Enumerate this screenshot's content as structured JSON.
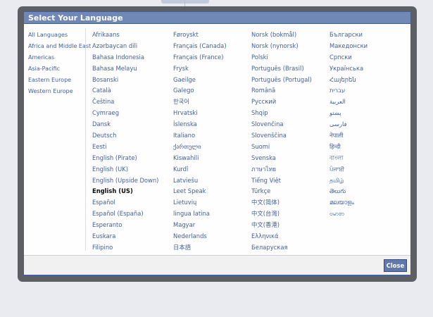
{
  "dialog": {
    "title": "Select Your Language",
    "close_label": "Close"
  },
  "regions": [
    "All Languages",
    "Africa and Middle East",
    "Americas",
    "Asia-Pacific",
    "Eastern Europe",
    "Western Europe"
  ],
  "selected_language": "English (US)",
  "columns": [
    [
      "Afrikaans",
      "Azərbaycan dili",
      "Bahasa Indonesia",
      "Bahasa Melayu",
      "Bosanski",
      "Català",
      "Čeština",
      "Cymraeg",
      "Dansk",
      "Deutsch",
      "Eesti",
      "English (Pirate)",
      "English (UK)",
      "English (Upside Down)",
      "English (US)",
      "Español",
      "Español (España)",
      "Esperanto",
      "Euskara",
      "Filipino"
    ],
    [
      "Føroyskt",
      "Français (Canada)",
      "Français (France)",
      "Frysk",
      "Gaeilge",
      "Galego",
      "한국어",
      "Hrvatski",
      "Íslenska",
      "Italiano",
      "ქართული",
      "Kiswahili",
      "Kurdî",
      "Latviešu",
      "Leet Speak",
      "Lietuvių",
      "lingua latina",
      "Magyar",
      "Nederlands",
      "日本語"
    ],
    [
      "Norsk (bokmål)",
      "Norsk (nynorsk)",
      "Polski",
      "Português (Brasil)",
      "Português (Portugal)",
      "Română",
      "Русский",
      "Shqip",
      "Slovenčina",
      "Slovenščina",
      "Suomi",
      "Svenska",
      "ภาษาไทย",
      "Tiếng Việt",
      "Türkçe",
      "中文(简体)",
      "中文(台灣)",
      "中文(香港)",
      "Ελληνικά",
      "Беларуская"
    ],
    [
      "Български",
      "Македонски",
      "Српски",
      "Українська",
      "Հայերեն",
      "עברית",
      "العربية",
      "پښتو",
      "فارسی",
      "नेपाली",
      "हिन्दी",
      "বাংলা",
      "ਪੰਜਾਬੀ",
      "தமிழ்",
      "తెలుగు",
      "മലയാളം",
      "ဗမာစာ"
    ]
  ]
}
